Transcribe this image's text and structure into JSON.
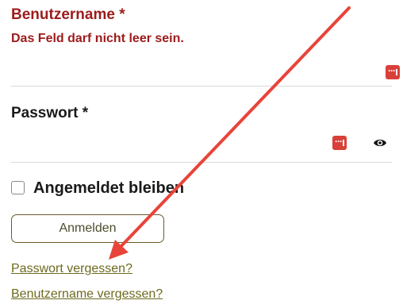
{
  "username": {
    "label": "Benutzername *",
    "error": "Das Feld darf nicht leer sein.",
    "value": "",
    "password_manager_icon": "password-manager-icon"
  },
  "password": {
    "label": "Passwort *",
    "value": "",
    "password_manager_icon": "password-manager-icon",
    "toggle_icon": "eye-icon"
  },
  "remember": {
    "label": "Angemeldet bleiben",
    "checked": false
  },
  "login_button": "Anmelden",
  "links": {
    "forgot_password": "Passwort vergessen?",
    "forgot_username": "Benutzername vergessen?"
  },
  "colors": {
    "error": "#9d1b1b",
    "link": "#6e6a1f",
    "button_border": "#6b5a2e",
    "password_manager": "#d9403a",
    "annotation_arrow": "#e8443a"
  }
}
